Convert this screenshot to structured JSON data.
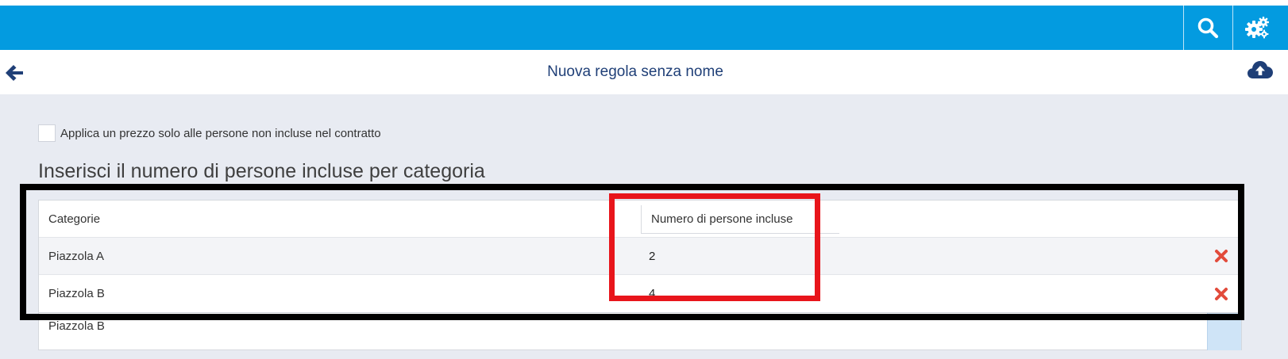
{
  "header": {
    "search_icon": "search-icon",
    "settings_icon": "gears-icon",
    "bar_color": "#039be0"
  },
  "subheader": {
    "back_icon": "arrow-left-icon",
    "title": "Nuova regola senza nome",
    "upload_icon": "cloud-upload-icon"
  },
  "form": {
    "checkbox_label": "Applica un prezzo solo alle persone non incluse nel contratto",
    "checkbox_checked": false,
    "section_title": "Inserisci il numero di persone incluse per categoria"
  },
  "table": {
    "columns": [
      "Categorie",
      "Numero di persone incluse"
    ],
    "rows": [
      {
        "category": "Piazzola A",
        "count": "2",
        "action_icon": "delete-x-icon"
      },
      {
        "category": "Piazzola B",
        "count": "4",
        "action_icon": "delete-x-icon"
      }
    ],
    "add_row_value": "Piazzola B"
  },
  "highlight_colors": {
    "outer_frame": "#000000",
    "column_frame": "#e8151b"
  }
}
